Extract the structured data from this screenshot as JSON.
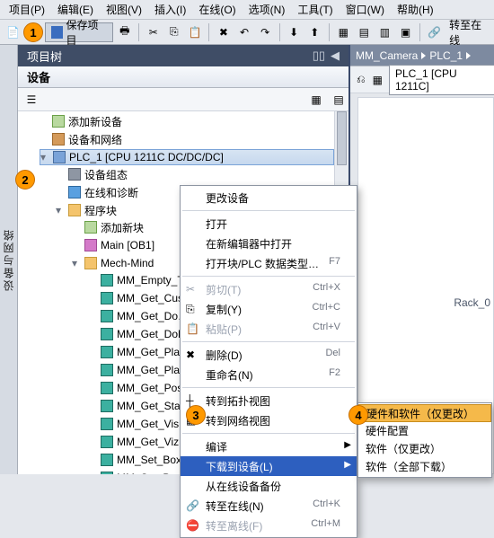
{
  "menus": {
    "project": "项目(P)",
    "edit": "编辑(E)",
    "view": "视图(V)",
    "insert": "插入(I)",
    "online": "在线(O)",
    "options": "选项(N)",
    "tools": "工具(T)",
    "window": "窗口(W)",
    "help": "帮助(H)"
  },
  "toolbar": {
    "save_project": "保存项目",
    "go_online": "转至在线"
  },
  "project_tree": {
    "title": "项目树",
    "devices_tab": "设备",
    "nodes": {
      "add_device": "添加新设备",
      "devices_networks": "设备和网络",
      "plc": "PLC_1 [CPU 1211C DC/DC/DC]",
      "device_config": "设备组态",
      "online_diag": "在线和诊断",
      "program_blocks": "程序块",
      "add_block": "添加新块",
      "main_ob": "Main [OB1]",
      "mech_mind": "Mech-Mind",
      "fb": [
        "MM_Empty_T…",
        "MM_Get_Cus…",
        "MM_Get_Do…",
        "MM_Get_DoLi…",
        "MM_Get_Plan…",
        "MM_Get_Pla…",
        "MM_Get_Pos…",
        "MM_Get_Stat…",
        "MM_Get_Vis…",
        "MM_Get_VizD…",
        "MM_Set_Box…",
        "MM_Set_Bran…"
      ]
    }
  },
  "sidebar_label": "设备与网络",
  "context_menu": {
    "change_device": "更改设备",
    "open": "打开",
    "open_in_editor": "在新编辑器中打开",
    "open_block": "打开块/PLC 数据类型…",
    "open_block_hk": "F7",
    "cut": "剪切(T)",
    "cut_hk": "Ctrl+X",
    "copy": "复制(Y)",
    "copy_hk": "Ctrl+C",
    "paste": "粘贴(P)",
    "paste_hk": "Ctrl+V",
    "delete": "删除(D)",
    "delete_hk": "Del",
    "rename": "重命名(N)",
    "rename_hk": "F2",
    "goto_topo": "转到拓扑视图",
    "goto_net": "转到网络视图",
    "compile": "编译",
    "download": "下载到设备(L)",
    "backup": "从在线设备备份",
    "go_online": "转至在线(N)",
    "go_online_hk": "Ctrl+K",
    "go_offline": "转至离线(F)",
    "go_offline_hk": "Ctrl+M"
  },
  "submenu": {
    "hw_sw_changes": "硬件和软件（仅更改）",
    "hw_config": "硬件配置",
    "sw_changes": "软件（仅更改）",
    "sw_all": "软件（全部下载）"
  },
  "markers": {
    "m1": "1",
    "m2": "2",
    "m3": "3",
    "m4": "4"
  },
  "right": {
    "crumb1": "MM_Camera",
    "crumb2": "PLC_1",
    "plc_name": "PLC_1 [CPU 1211C]",
    "rack": "Rack_0"
  }
}
